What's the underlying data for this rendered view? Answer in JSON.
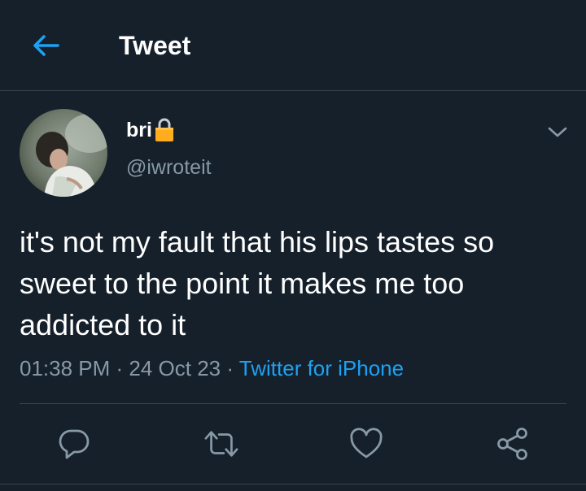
{
  "header": {
    "title": "Tweet",
    "back_icon": "arrow-left-icon"
  },
  "tweet": {
    "display_name": "bri",
    "protected_icon": "lock-icon",
    "handle": "@iwroteit",
    "text": "it's not my fault that his lips tastes so\nsweet to the point it makes me too\naddicted to it",
    "time": "01:38 PM",
    "separator": " · ",
    "date": "24 Oct 23",
    "source": "Twitter for iPhone"
  },
  "actions": {
    "reply_icon": "reply-icon",
    "retweet_icon": "retweet-icon",
    "like_icon": "heart-icon",
    "share_icon": "share-icon"
  },
  "colors": {
    "background": "#15202b",
    "accent": "#1da1f2",
    "muted": "#8899a6",
    "divider": "#38444d",
    "lock": "#ffad1f"
  }
}
